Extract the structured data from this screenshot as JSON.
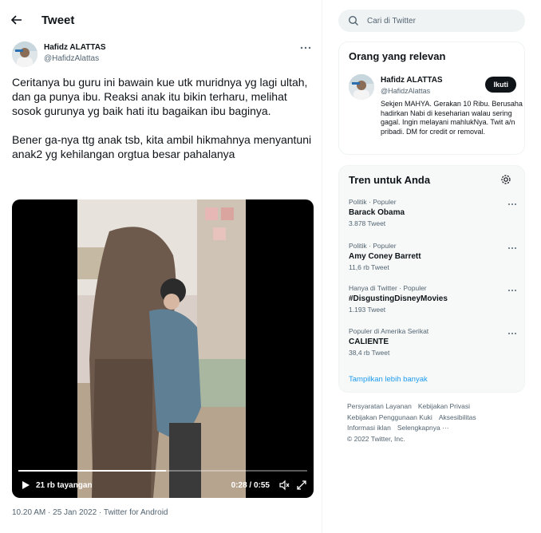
{
  "header": {
    "title": "Tweet"
  },
  "tweet": {
    "author_name": "Hafidz ALATTAS",
    "author_handle": "@HafidzAlattas",
    "paragraph1": "Ceritanya bu guru ini bawain kue utk muridnya  yg lagi ultah, dan ga punya ibu. Reaksi anak itu bikin terharu, melihat sosok gurunya yg baik hati itu bagaikan ibu baginya.",
    "paragraph2": "Bener ga-nya ttg anak tsb, kita ambil hikmahnya menyantuni anak2 yg kehilangan orgtua besar pahalanya",
    "timestamp": "10.20 AM · 25 Jan 2022 · Twitter for Android"
  },
  "video": {
    "views": "21 rb tayangan",
    "time": "0:28 / 0:55",
    "progress": 0.51
  },
  "search": {
    "placeholder": "Cari di Twitter"
  },
  "relevant": {
    "title": "Orang yang relevan",
    "name": "Hafidz ALATTAS",
    "handle": "@HafidzAlattas",
    "follow_label": "Ikuti",
    "bio": "Sekjen MAHYA. Gerakan 10 Ribu. Berusaha hadirkan Nabi di keseharian walau sering gagal. Ingin melayani mahlukNya. Twit a/n pribadi. DM for credit or removal."
  },
  "trends": {
    "title": "Tren untuk Anda",
    "items": [
      {
        "context": "Politik · Populer",
        "name": "Barack Obama",
        "count": "3.878 Tweet"
      },
      {
        "context": "Politik · Populer",
        "name": "Amy Coney Barrett",
        "count": "11,6 rb Tweet"
      },
      {
        "context": "Hanya di Twitter · Populer",
        "name": "#DisgustingDisneyMovies",
        "count": "1.193 Tweet"
      },
      {
        "context": "Populer di Amerika Serikat",
        "name": "CALIENTE",
        "count": "38,4 rb Tweet"
      }
    ],
    "show_more": "Tampilkan lebih banyak"
  },
  "footer": {
    "links": [
      "Persyaratan Layanan",
      "Kebijakan Privasi",
      "Kebijakan Penggunaan Kuki",
      "Aksesibilitas",
      "Informasi iklan",
      "Selengkapnya ···"
    ],
    "copyright": "© 2022 Twitter, Inc."
  },
  "colors": {
    "accent": "#1d9bf0",
    "text": "#0f1419",
    "muted": "#536471"
  }
}
